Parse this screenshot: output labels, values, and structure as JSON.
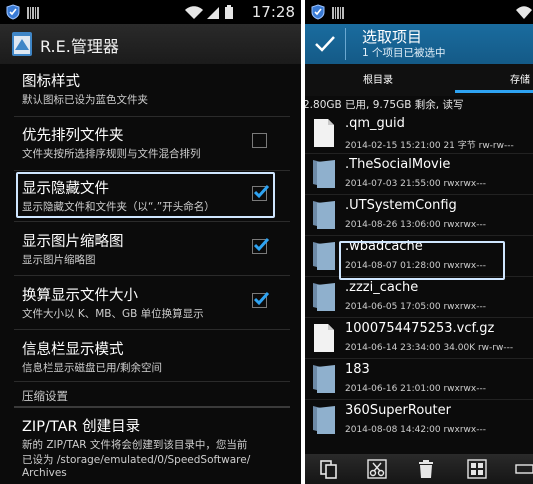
{
  "left": {
    "status_time": "17:28",
    "app_title": "R.E.管理器",
    "settings": [
      {
        "title": "图标样式",
        "subtitle": "默认图标已设为蓝色文件夹"
      },
      {
        "title": "优先排列文件夹",
        "subtitle": "文件夹按所选排序规则与文件混合排列",
        "checked": false
      },
      {
        "title": "显示隐藏文件",
        "subtitle": "显示隐藏文件和文件夹（以“.”开头命名）",
        "checked": true
      },
      {
        "title": "显示图片缩略图",
        "subtitle": "显示图片缩略图",
        "checked": true
      },
      {
        "title": "换算显示文件大小",
        "subtitle": "文件大小以 K、MB、GB 单位换算显示",
        "checked": true
      },
      {
        "title": "信息栏显示模式",
        "subtitle": "信息栏显示磁盘已用/剩余空间"
      }
    ],
    "section_label": "压缩设置",
    "zip": {
      "title": "ZIP/TAR 创建目录",
      "line1": "新的 ZIP/TAR 文件将会创建到该目录中，您当前",
      "line2": "已设为 /storage/emulated/0/SpeedSoftware/",
      "line3": "Archives"
    }
  },
  "right": {
    "header_title": "选取项目",
    "header_subtitle": "1 个项目已被选中",
    "tab_root": "根目录",
    "tab_storage": "存储",
    "path_info": "2.80GB 已用, 9.75GB 剩余, 读写",
    "files": [
      {
        "name": ".qm_guid",
        "meta": "2014-02-15 15:21:00  21 字节  rw-rw---",
        "type": "file"
      },
      {
        "name": ".TheSocialMovie",
        "meta": "2014-07-03 21:55:00    rwxrwx---",
        "type": "folder"
      },
      {
        "name": ".UTSystemConfig",
        "meta": "2014-08-26 13:06:00    rwxrwx---",
        "type": "folder"
      },
      {
        "name": ".wbadcache",
        "meta": "2014-08-07 01:28:00    rwxrwx---",
        "type": "folder"
      },
      {
        "name": ".zzzi_cache",
        "meta": "2014-06-05 17:05:00    rwxrwx---",
        "type": "folder"
      },
      {
        "name": "1000754475253.vcf.gz",
        "meta": "2014-06-14 23:34:00  34.00K  rw-rw---",
        "type": "file"
      },
      {
        "name": "183",
        "meta": "2014-06-16 21:01:00    rwxrwx---",
        "type": "folder"
      },
      {
        "name": "360SuperRouter",
        "meta": "2014-08-08 14:42:00    rwxrwx---",
        "type": "folder"
      }
    ]
  },
  "colors": {
    "accent": "#2ea3f2",
    "header": "#1a6c9f",
    "background": "#0b0b0b",
    "highlight": "#cfe6ff"
  }
}
